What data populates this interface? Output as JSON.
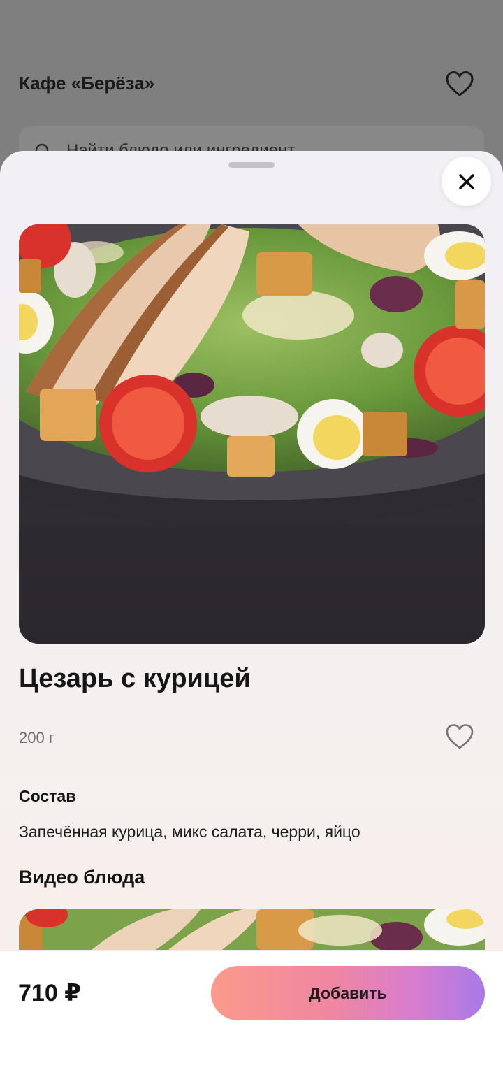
{
  "background": {
    "cafe_title": "Кафе «Берёза»",
    "search_placeholder": "Найти блюдо или ингредиент"
  },
  "sheet": {
    "dish": {
      "name": "Цезарь с курицей",
      "weight": "200 г",
      "composition_title": "Состав",
      "composition": "Запечённая курица, микс салата, черри, яйцо",
      "video_title": "Видео блюда"
    },
    "bottom_bar": {
      "price": "710 ₽",
      "add_label": "Добавить"
    }
  },
  "colors": {
    "accent_gradient": [
      "#fb9a8b",
      "#ef86a3",
      "#d77ccf",
      "#a77ae8"
    ],
    "overlay": "#7f7f7f"
  },
  "icons": [
    "heart-icon",
    "search-icon",
    "close-icon",
    "favorite-heart-icon"
  ]
}
